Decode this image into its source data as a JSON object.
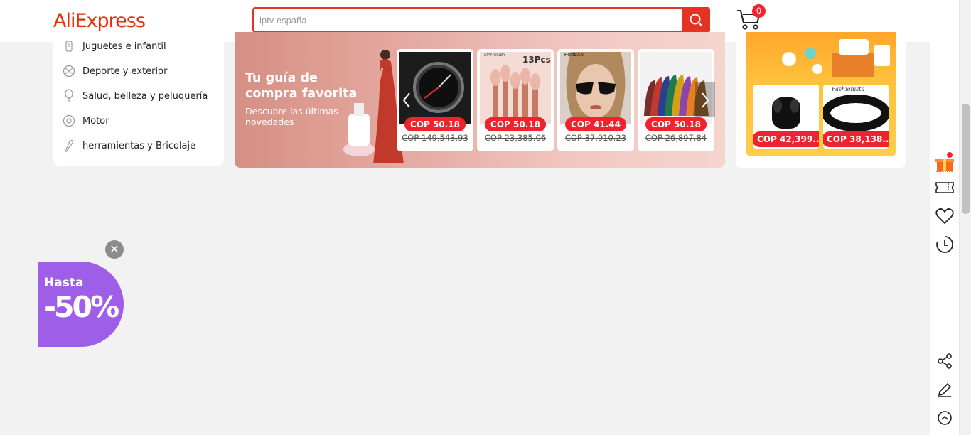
{
  "header": {
    "logo": "AliExpress",
    "search_placeholder": "iptv españa",
    "cart_count": "0"
  },
  "categories": [
    {
      "label": "Juguetes e infantil",
      "icon": "toy-icon"
    },
    {
      "label": "Deporte y exterior",
      "icon": "ball-icon"
    },
    {
      "label": "Salud, belleza y peluquería",
      "icon": "beauty-icon"
    },
    {
      "label": "Motor",
      "icon": "wheel-icon"
    },
    {
      "label": "herramientas y Bricolaje",
      "icon": "tools-icon"
    }
  ],
  "banner": {
    "title": "Tu guía de compra favorita",
    "subtitle": "Descubre las últimas novedades",
    "products": [
      {
        "price": "COP 50.18",
        "old_price": "COP 149,543.93",
        "image": "watch"
      },
      {
        "price": "COP 50.18",
        "old_price": "COP 23,385.06",
        "image": "brushes",
        "brand": "MANGOBY",
        "tag": "13Pcs"
      },
      {
        "price": "COP 41.44",
        "old_price": "COP 37,910.23",
        "image": "sunglasses",
        "brand": "HOOBAN"
      },
      {
        "price": "COP 50.18",
        "old_price": "COP 26,897.84",
        "image": "beanies"
      }
    ]
  },
  "promo": {
    "products": [
      {
        "price": "COP 42,399...",
        "image": "earbuds"
      },
      {
        "price": "COP 38,138...",
        "image": "belt",
        "brand": "Fashionista"
      }
    ]
  },
  "floater": {
    "close": "✕",
    "upto": "Hasta",
    "percent": "-50%"
  },
  "colors": {
    "brand": "#e62e04",
    "accent": "#e43225",
    "price_red": "#f0232c",
    "discount_purple": "#9f5ee8",
    "promo_yellow": "#ffc23d"
  }
}
